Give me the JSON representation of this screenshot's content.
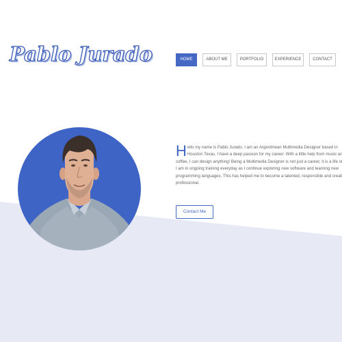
{
  "brand": {
    "logo_text": "Pablo Jurado"
  },
  "nav": {
    "items": [
      {
        "label": "HOME",
        "active": true
      },
      {
        "label": "ABOUT ME",
        "active": false
      },
      {
        "label": "PORTFOLIO",
        "active": false
      },
      {
        "label": "EXPERIENCE",
        "active": false
      },
      {
        "label": "CONTACT",
        "active": false
      }
    ]
  },
  "intro": {
    "dropcap": "H",
    "text": "ello my name is Pablo Jurado. I am an Argentinean Multimedia Designer based in Houston Texas. I have a deep passion for my career. With a little help from music and coffee, I can design anything! Being a Multimedia Designer is not just a career, it is a life style. I am in ongoing training everyday as I continue exploring new software and learning new programming languages. This has helped me to become a talented, responsible and creative professional."
  },
  "cta": {
    "label": "Contact Me"
  },
  "colors": {
    "accent": "#4468c4",
    "avatar_circle": "#3e64c6",
    "lower_band": "#e7e9f5"
  }
}
